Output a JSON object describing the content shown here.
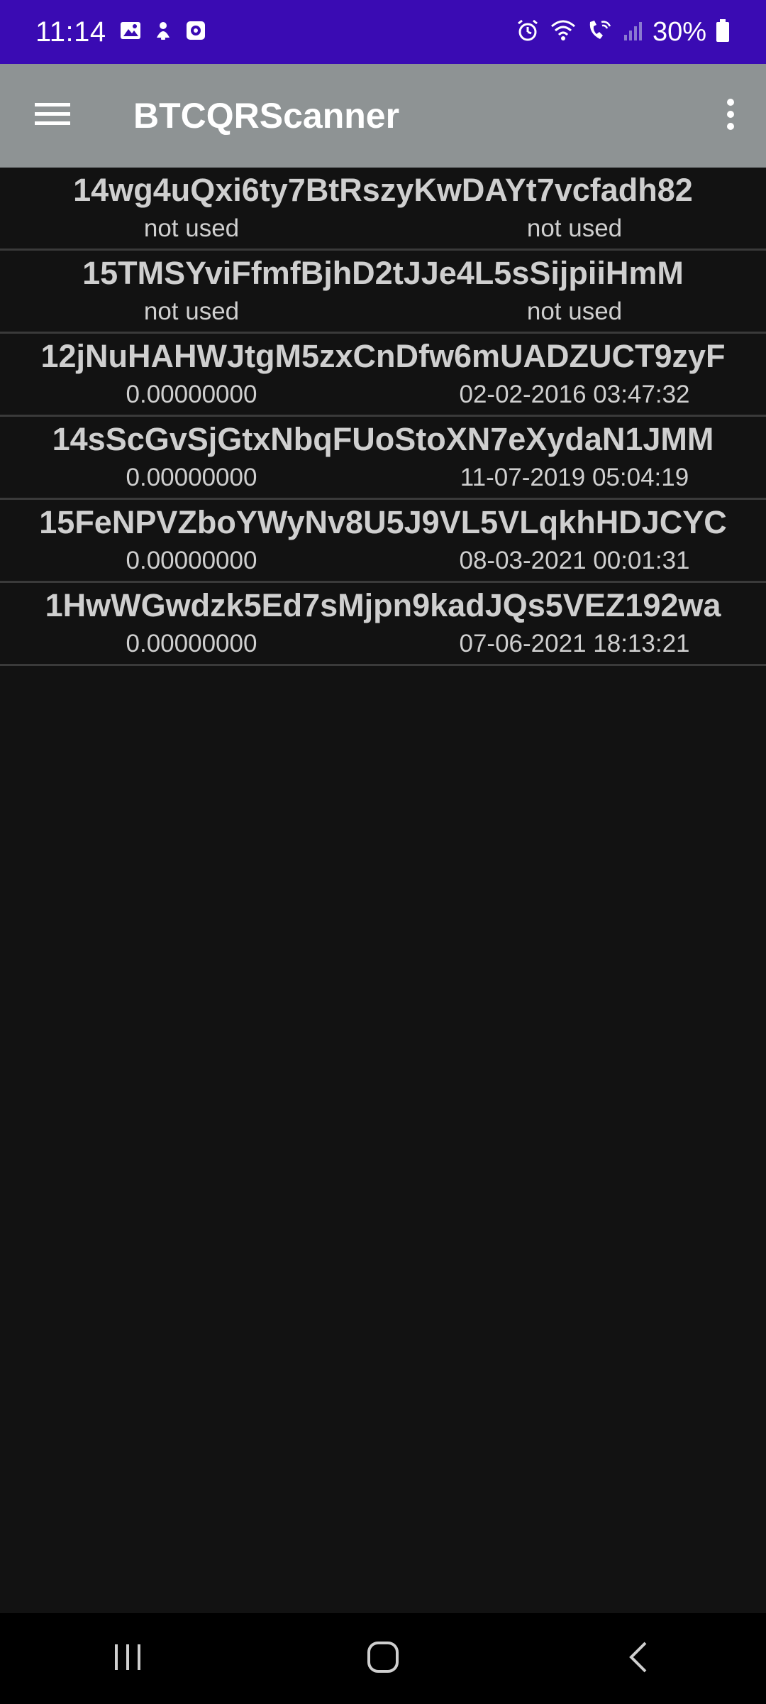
{
  "status_bar": {
    "time": "11:14",
    "battery_percent": "30%",
    "background_color": "#3a0bb3",
    "icons_left": [
      "gallery-icon",
      "notification-icon",
      "app-icon"
    ],
    "icons_right": [
      "alarm-icon",
      "wifi-icon",
      "wifi-calling-icon",
      "signal-icon",
      "battery-icon"
    ]
  },
  "app_bar": {
    "title": "BTCQRScanner",
    "background_color": "#8e9394",
    "menu_icon": "hamburger-menu-icon",
    "overflow_icon": "more-vertical-icon"
  },
  "list": {
    "items": [
      {
        "address": "14wg4uQxi6ty7BtRszyKwDAYt7vcfadh82",
        "balance": "not used",
        "last_used": "not used"
      },
      {
        "address": "15TMSYviFfmfBjhD2tJJe4L5sSijpiiHmM",
        "balance": "not used",
        "last_used": "not used"
      },
      {
        "address": "12jNuHAHWJtgM5zxCnDfw6mUADZUCT9zyF",
        "balance": "0.00000000",
        "last_used": "02-02-2016 03:47:32"
      },
      {
        "address": "14sScGvSjGtxNbqFUoStoXN7eXydaN1JMM",
        "balance": "0.00000000",
        "last_used": "11-07-2019 05:04:19"
      },
      {
        "address": "15FeNPVZboYWyNv8U5J9VL5VLqkhHDJCYC",
        "balance": "0.00000000",
        "last_used": "08-03-2021 00:01:31"
      },
      {
        "address": "1HwWGwdzk5Ed7sMjpn9kadJQs5VEZ192wa",
        "balance": "0.00000000",
        "last_used": "07-06-2021 18:13:21"
      }
    ]
  },
  "nav_bar": {
    "buttons": [
      "recent-apps-icon",
      "home-icon",
      "back-icon"
    ]
  }
}
